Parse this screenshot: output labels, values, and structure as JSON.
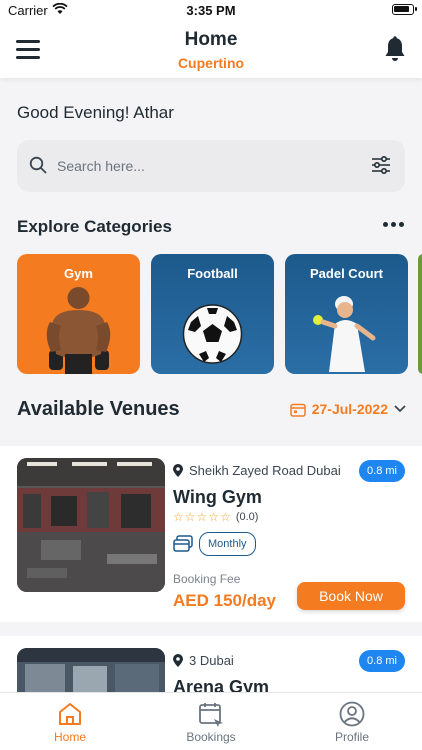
{
  "status_bar": {
    "carrier": "Carrier",
    "time": "3:35 PM"
  },
  "header": {
    "title": "Home",
    "subtitle": "Cupertino"
  },
  "greeting": "Good Evening! Athar",
  "search": {
    "placeholder": "Search here..."
  },
  "categories": {
    "title": "Explore Categories",
    "items": [
      {
        "label": "Gym"
      },
      {
        "label": "Football"
      },
      {
        "label": "Padel Court"
      }
    ]
  },
  "venues": {
    "title": "Available Venues",
    "date": "27-Jul-2022",
    "items": [
      {
        "location": "Sheikh Zayed Road  Dubai",
        "distance": "0.8 mi",
        "name": "Wing Gym",
        "rating_text": "(0.0)",
        "plan": "Monthly",
        "fee_label": "Booking Fee",
        "fee": "AED 150/day",
        "book_label": "Book Now"
      },
      {
        "location": "3  Dubai",
        "distance": "0.8 mi",
        "name": "Arena Gym"
      }
    ]
  },
  "tabs": [
    {
      "label": "Home",
      "active": true
    },
    {
      "label": "Bookings",
      "active": false
    },
    {
      "label": "Profile",
      "active": false
    }
  ],
  "colors": {
    "accent": "#f47b20",
    "primary": "#1d5a8c",
    "badge": "#1e86f0"
  }
}
